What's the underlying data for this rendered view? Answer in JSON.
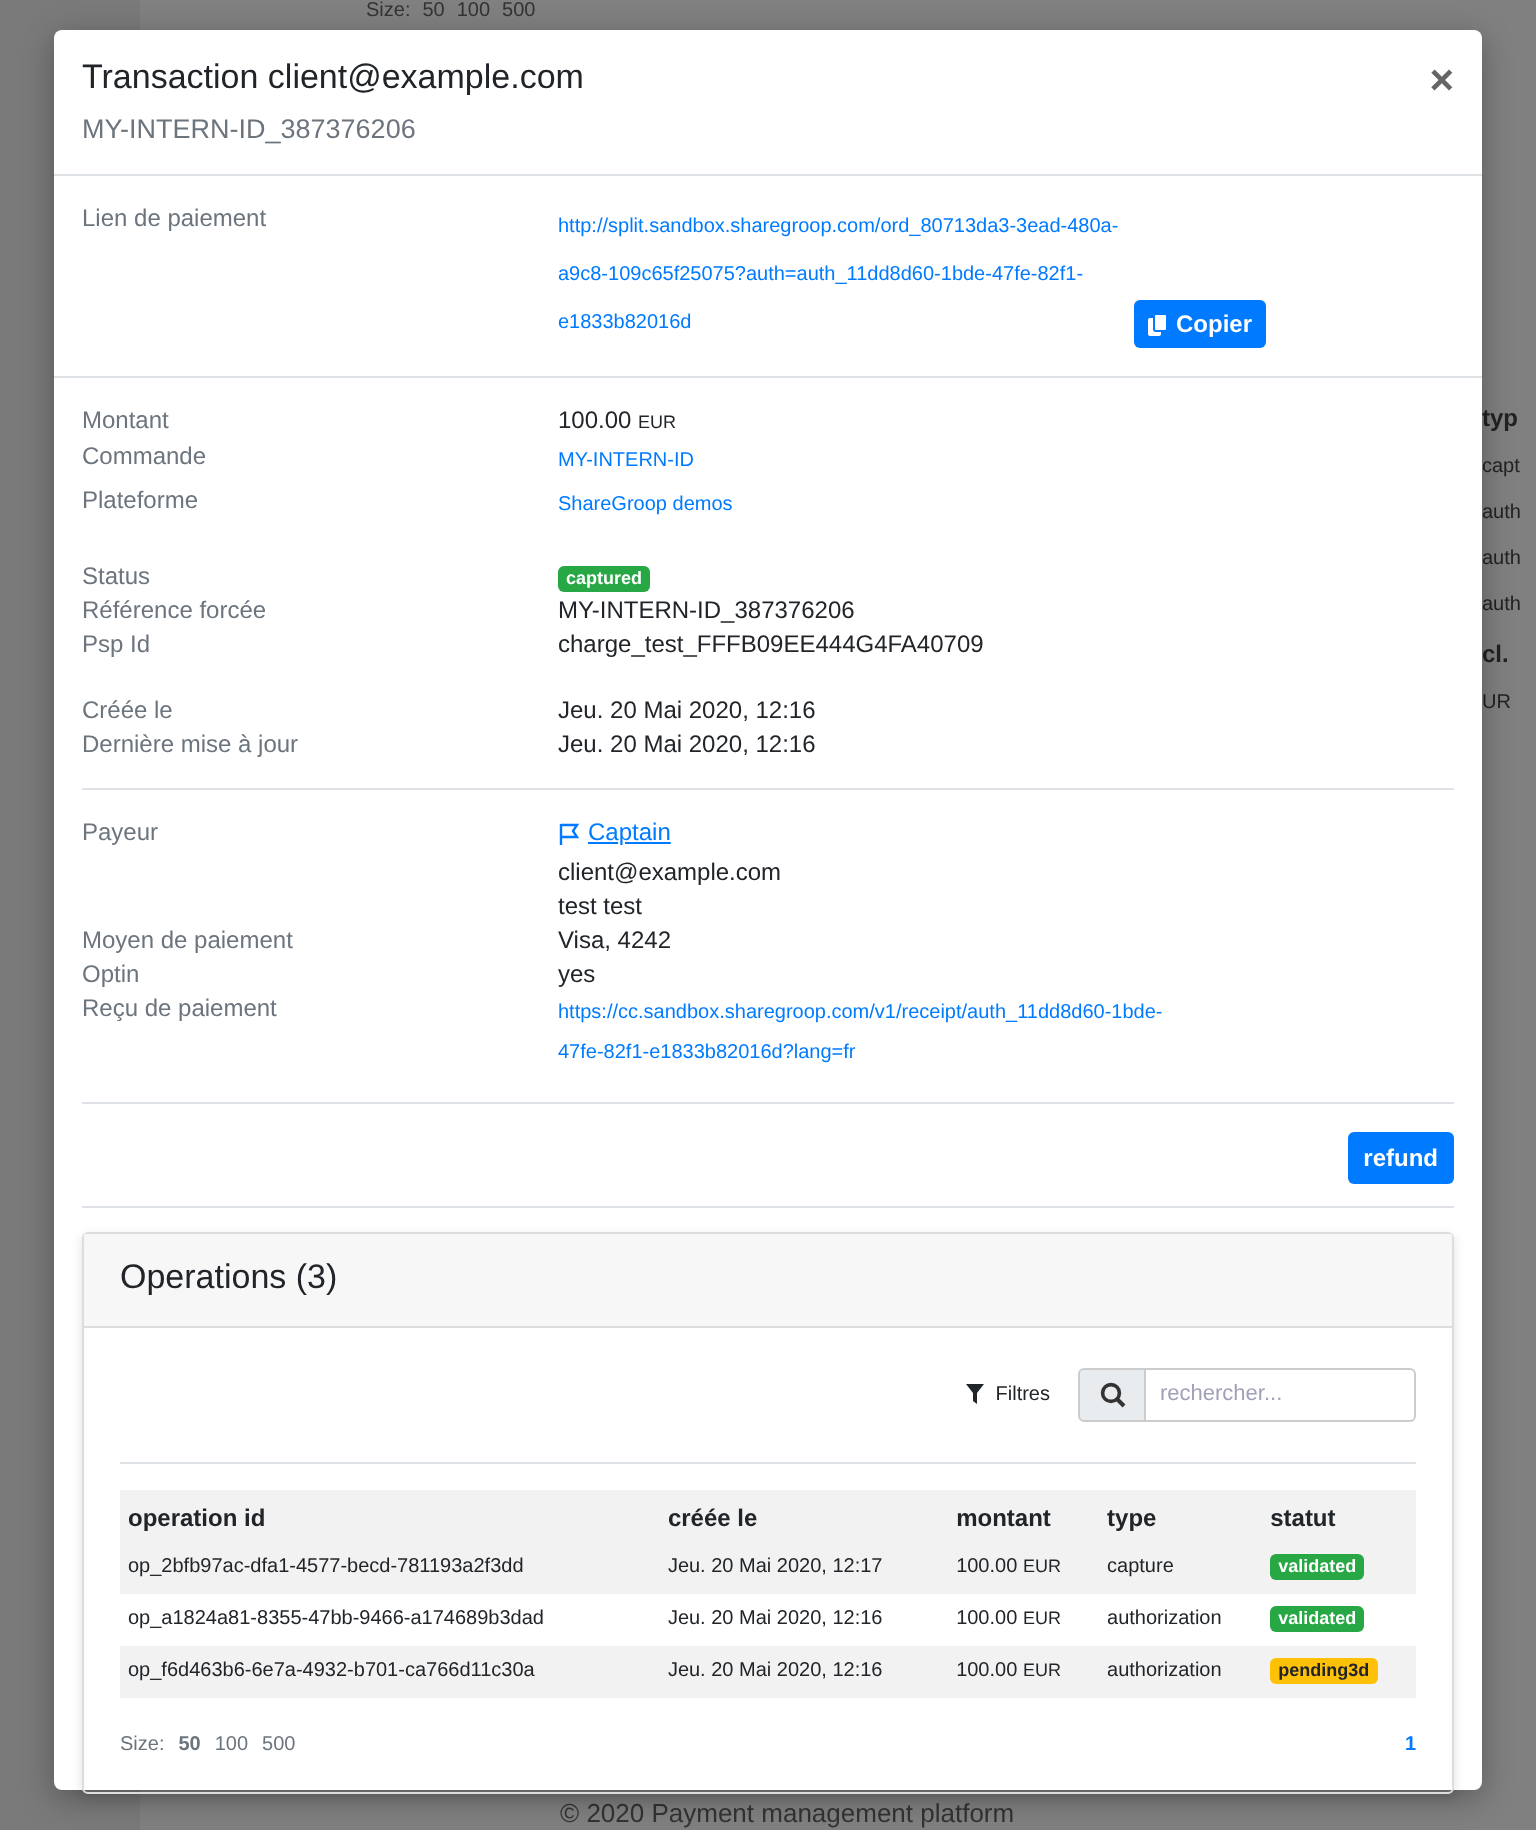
{
  "background": {
    "size_label": "Size:",
    "sizes": [
      "50",
      "100",
      "500"
    ],
    "side_texts": [
      {
        "text": "typ",
        "kind": "head"
      },
      {
        "text": "capt",
        "kind": "cell"
      },
      {
        "text": "auth",
        "kind": "cell"
      },
      {
        "text": "auth",
        "kind": "cell"
      },
      {
        "text": "auth",
        "kind": "cell"
      },
      {
        "text": "cl.",
        "kind": "head"
      },
      {
        "text": "UR",
        "kind": "cell"
      }
    ],
    "footer": "© 2020 Payment management platform"
  },
  "modal": {
    "title": "Transaction client@example.com",
    "subtitle": "MY-INTERN-ID_387376206",
    "close": "×",
    "sections": [
      {
        "groups": [
          {
            "rows": [
              {
                "label": "Lien de paiement",
                "kind": "link_copy",
                "value": "http://split.sandbox.sharegroop.com/ord_80713da3-3ead-480a-a9c8-109c65f25075?auth=auth_11dd8d60-1bde-47fe-82f1-e1833b82016d",
                "button": "Copier"
              }
            ]
          }
        ]
      },
      {
        "groups": [
          {
            "rows": [
              {
                "label": "Montant",
                "kind": "amount",
                "value": "100.00",
                "currency": "EUR"
              },
              {
                "label": "Commande",
                "kind": "link",
                "value": "MY-INTERN-ID"
              },
              {
                "label": "Plateforme",
                "kind": "link",
                "value": "ShareGroop demos"
              }
            ]
          },
          {
            "rows": [
              {
                "label": "Status",
                "kind": "badge",
                "value": "captured",
                "color": "#28a745"
              },
              {
                "label": "Référence forcée",
                "kind": "text",
                "value": "MY-INTERN-ID_387376206"
              },
              {
                "label": "Psp Id",
                "kind": "text",
                "value": "charge_test_FFFB09EE444G4FA40709"
              }
            ]
          },
          {
            "rows": [
              {
                "label": "Créée le",
                "kind": "text",
                "value": "Jeu. 20 Mai 2020, 12:16"
              },
              {
                "label": "Dernière mise à jour",
                "kind": "text",
                "value": "Jeu. 20 Mai 2020, 12:16"
              }
            ]
          }
        ]
      },
      {
        "groups": [
          {
            "rows": [
              {
                "label": "Payeur",
                "kind": "payer",
                "value": "Captain",
                "lines": [
                  "client@example.com",
                  "test test"
                ]
              },
              {
                "label": "Moyen de paiement",
                "kind": "text",
                "value": "Visa, 4242"
              },
              {
                "label": "Optin",
                "kind": "text",
                "value": "yes"
              },
              {
                "label": "Reçu de paiement",
                "kind": "link",
                "value": "https://cc.sandbox.sharegroop.com/v1/receipt/auth_11dd8d60-1bde-47fe-82f1-e1833b82016d?lang=fr"
              }
            ]
          }
        ]
      }
    ],
    "refund": "refund",
    "operations": {
      "title": "Operations (3)",
      "filter": "Filtres",
      "search": {
        "placeholder": "rechercher..."
      },
      "columns": [
        "operation id",
        "créée le",
        "montant",
        "type",
        "statut"
      ],
      "rows": [
        {
          "id": "op_2bfb97ac-dfa1-4577-becd-781193a2f3dd",
          "created": "Jeu. 20 Mai 2020, 12:17",
          "amount": "100.00",
          "currency": "EUR",
          "type": "capture",
          "status": "validated",
          "color": "#28a745"
        },
        {
          "id": "op_a1824a81-8355-47bb-9466-a174689b3dad",
          "created": "Jeu. 20 Mai 2020, 12:16",
          "amount": "100.00",
          "currency": "EUR",
          "type": "authorization",
          "status": "validated",
          "color": "#28a745"
        },
        {
          "id": "op_f6d463b6-6e7a-4932-b701-ca766d11c30a",
          "created": "Jeu. 20 Mai 2020, 12:16",
          "amount": "100.00",
          "currency": "EUR",
          "type": "authorization",
          "status": "pending3d",
          "color": "#ffc107"
        }
      ],
      "size_label": "Size:",
      "sizes": [
        {
          "label": "50",
          "selected": true
        },
        {
          "label": "100",
          "selected": false
        },
        {
          "label": "500",
          "selected": false
        }
      ],
      "pages": [
        {
          "label": "1",
          "selected": true
        }
      ]
    }
  }
}
